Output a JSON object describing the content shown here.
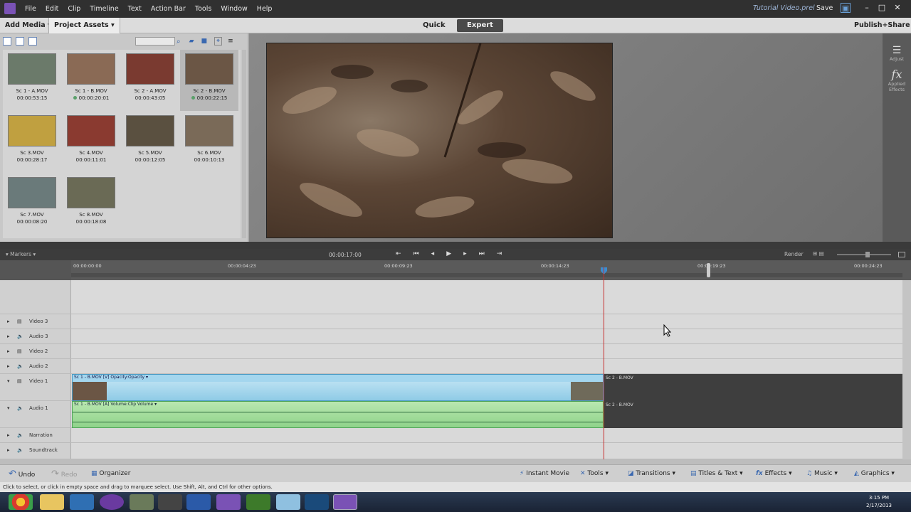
{
  "menu": [
    "File",
    "Edit",
    "Clip",
    "Timeline",
    "Text",
    "Action Bar",
    "Tools",
    "Window",
    "Help"
  ],
  "doc_title": "Tutorial Video.prel",
  "save_label": "Save",
  "toolbar": {
    "add_media": "Add Media",
    "project_assets": "Project Assets",
    "quick": "Quick",
    "expert": "Expert",
    "publish": "Publish+Share"
  },
  "assets": [
    {
      "name": "Sc 1 - A.MOV",
      "dur": "00:00:53:15",
      "used": false
    },
    {
      "name": "Sc 1 - B.MOV",
      "dur": "00:00:20:01",
      "used": true
    },
    {
      "name": "Sc 2 - A.MOV",
      "dur": "00:00:43:05",
      "used": false
    },
    {
      "name": "Sc 2 - B.MOV",
      "dur": "00:00:22:15",
      "used": true
    },
    {
      "name": "Sc 3.MOV",
      "dur": "00:00:28:17",
      "used": false
    },
    {
      "name": "Sc 4.MOV",
      "dur": "00:00:11:01",
      "used": false
    },
    {
      "name": "Sc 5.MOV",
      "dur": "00:00:12:05",
      "used": false
    },
    {
      "name": "Sc 6.MOV",
      "dur": "00:00:10:13",
      "used": false
    },
    {
      "name": "Sc 7.MOV",
      "dur": "00:00:08:20",
      "used": false
    },
    {
      "name": "Sc 8.MOV",
      "dur": "00:00:18:08",
      "used": false
    }
  ],
  "side": {
    "adjust": "Adjust",
    "applied": "Applied Effects"
  },
  "timeline": {
    "markers": "Markers",
    "timecode": "00:00:17:00",
    "render": "Render",
    "ticks": [
      "00:00:00:00",
      "00:00:04:23",
      "00:00:09:23",
      "00:00:14:23",
      "00:00:19:23",
      "00:00:24:23"
    ]
  },
  "tracks": [
    "Video 3",
    "Audio 3",
    "Video 2",
    "Audio 2",
    "Video 1",
    "Audio 1",
    "Narration",
    "Soundtrack"
  ],
  "clips": {
    "v1": "Sc 1 - B.MOV [V]",
    "v1fx": "Opacity:Opacity",
    "a1": "Sc 1 - B.MOV [A]",
    "a1fx": "Volume:Clip Volume",
    "next": "Sc 2 - B.MOV"
  },
  "bottom": {
    "undo": "Undo",
    "redo": "Redo",
    "organizer": "Organizer",
    "instant": "Instant Movie",
    "tools": "Tools",
    "transitions": "Transitions",
    "titles": "Titles & Text",
    "effects": "Effects",
    "music": "Music",
    "graphics": "Graphics"
  },
  "status": "Click to select, or click in empty space and drag to marquee select. Use Shift, Alt, and Ctrl for other options.",
  "clock": {
    "time": "3:15 PM",
    "date": "2/17/2013"
  }
}
